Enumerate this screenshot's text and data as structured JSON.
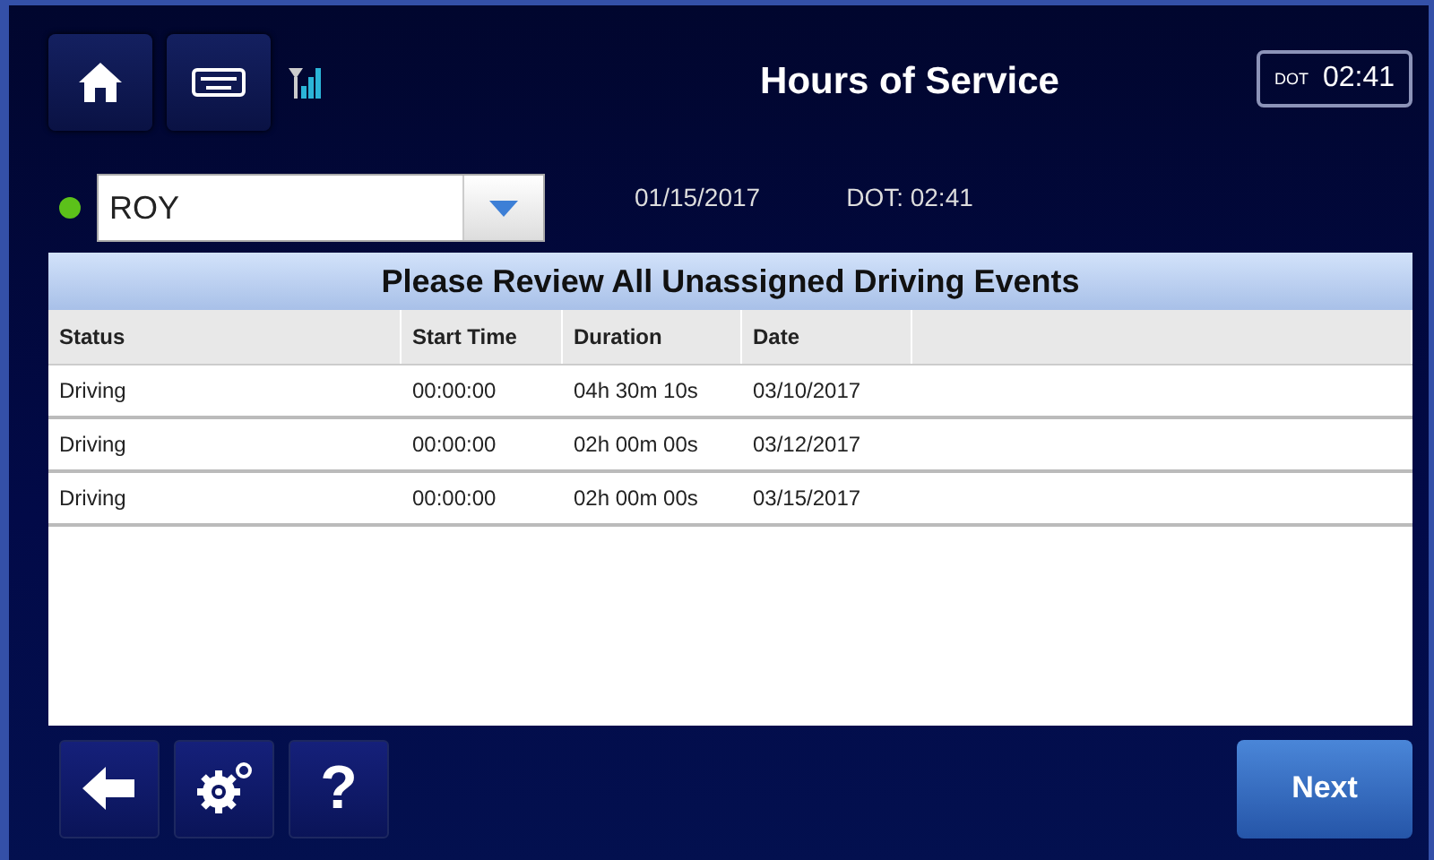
{
  "header": {
    "title": "Hours of Service",
    "dot_badge": {
      "label": "DOT",
      "time": "02:41"
    }
  },
  "driver": {
    "value": "ROY",
    "date": "01/15/2017",
    "dot_time": "DOT: 02:41"
  },
  "table": {
    "title": "Please Review All Unassigned Driving Events",
    "columns": [
      "Status",
      "Start Time",
      "Duration",
      "Date"
    ],
    "rows": [
      [
        "Driving",
        "00:00:00",
        "04h 30m 10s",
        "03/10/2017"
      ],
      [
        "Driving",
        "00:00:00",
        "02h 00m 00s",
        "03/12/2017"
      ],
      [
        "Driving",
        "00:00:00",
        "02h 00m 00s",
        "03/15/2017"
      ]
    ]
  },
  "footer": {
    "help_label": "?",
    "next_label": "Next"
  }
}
